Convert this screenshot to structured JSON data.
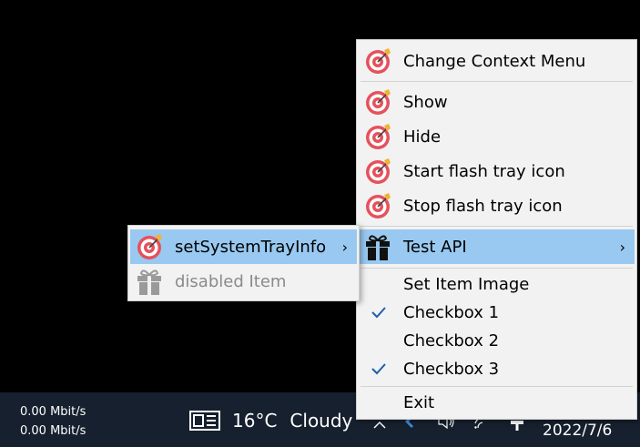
{
  "taskbar": {
    "net_up": "0.00 Mbit/s",
    "net_down": "0.00 Mbit/s",
    "weather_temp": "16°C",
    "weather_cond": "Cloudy",
    "date": "2022/7/6"
  },
  "main_menu": {
    "items": [
      {
        "label": "Change Context Menu",
        "icon": "target-icon"
      },
      {
        "label": "Show",
        "icon": "target-icon"
      },
      {
        "label": "Hide",
        "icon": "target-icon"
      },
      {
        "label": "Start flash tray icon",
        "icon": "target-icon"
      },
      {
        "label": "Stop flash tray icon",
        "icon": "target-icon"
      },
      {
        "label": "Test API",
        "icon": "gift-icon",
        "submenu": true
      },
      {
        "label": "Set Item Image"
      },
      {
        "label": "Checkbox 1",
        "checked": true
      },
      {
        "label": "Checkbox 2",
        "checked": false
      },
      {
        "label": "Checkbox 3",
        "checked": true
      },
      {
        "label": "Exit"
      }
    ],
    "highlight_color": "#99c9f1"
  },
  "sub_menu": {
    "items": [
      {
        "label": "setSystemTrayInfo",
        "icon": "target-icon",
        "submenu": true,
        "highlighted": true
      },
      {
        "label": "disabled Item",
        "icon": "gift-icon",
        "disabled": true
      }
    ]
  }
}
